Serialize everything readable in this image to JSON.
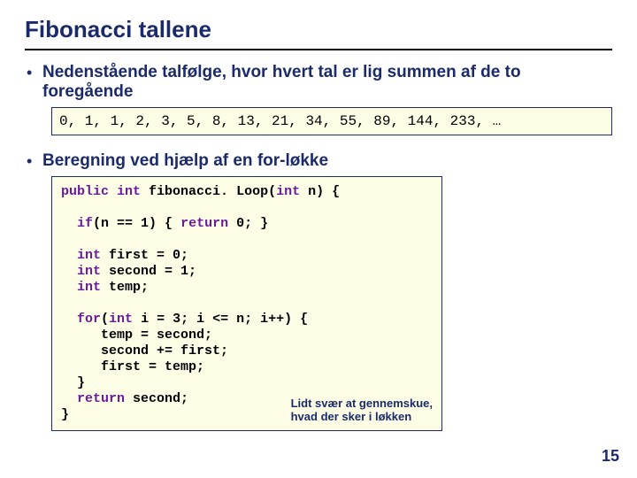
{
  "title": "Fibonacci tallene",
  "bullets": {
    "b1": "Nedenstående talfølge, hvor hvert tal er lig summen af de to foregående",
    "b2": "Beregning ved hjælp af en for-løkke"
  },
  "sequence": "0, 1, 1, 2, 3, 5, 8, 13, 21, 34, 55, 89, 144, 233, …",
  "code": {
    "kw_public": "public",
    "kw_int1": "int",
    "fn_name": " fibonacci. Loop(",
    "kw_int2": "int",
    "param": " n) {",
    "if_kw": "if",
    "if_cond": "(n == 1) { ",
    "kw_return0": "return",
    "ret0": " 0; }",
    "kw_int3": "int",
    "decl1": " first = 0;",
    "kw_int4": "int",
    "decl2": " second = 1;",
    "kw_int5": "int",
    "decl3": " temp;",
    "kw_for": "for",
    "for_open": "(",
    "kw_int6": "int",
    "for_rest": " i = 3; i <= n; i++) {",
    "body1": "temp = second;",
    "body2": "second += first;",
    "body3": "first = temp;",
    "body4": "}",
    "kw_return1": "return",
    "ret1": " second;",
    "close": "}"
  },
  "annotation": {
    "line1": "Lidt svær at gennemskue,",
    "line2": "hvad der sker i løkken"
  },
  "page_number": "15"
}
